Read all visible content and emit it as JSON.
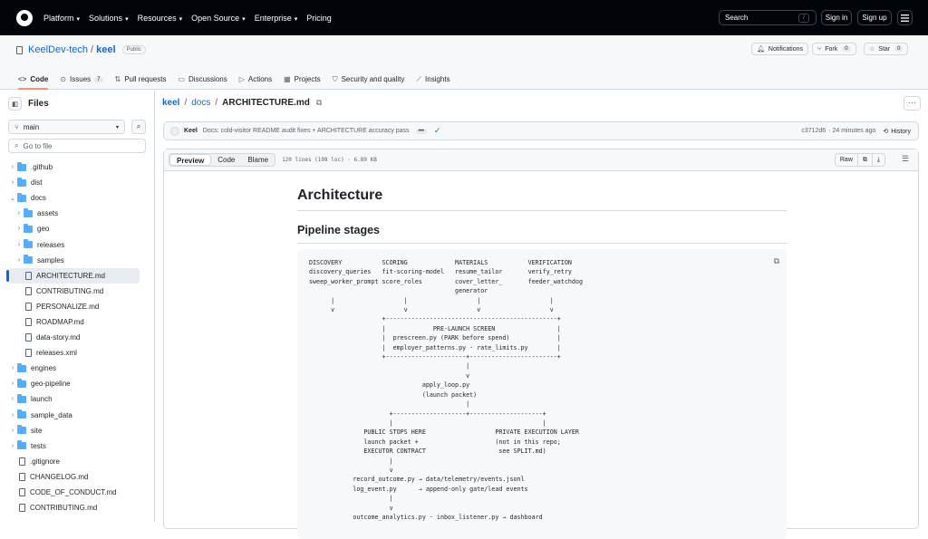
{
  "topbar": {
    "nav": [
      "Platform",
      "Solutions",
      "Resources",
      "Open Source",
      "Enterprise",
      "Pricing"
    ],
    "search_label": "Search",
    "search_key": "/",
    "signin": "Sign in",
    "signup": "Sign up"
  },
  "repo": {
    "owner": "KeelDev-tech",
    "sep": "/",
    "name": "keel",
    "visibility": "Public",
    "notifications": "Notifications",
    "fork": "Fork",
    "fork_count": "0",
    "star": "Star",
    "star_count": "0"
  },
  "tabs": [
    {
      "label": "Code",
      "icon": "code-icon"
    },
    {
      "label": "Issues",
      "count": "7",
      "icon": "issue-icon"
    },
    {
      "label": "Pull requests",
      "icon": "pull-request-icon"
    },
    {
      "label": "Discussions",
      "icon": "discussion-icon"
    },
    {
      "label": "Actions",
      "icon": "play-icon"
    },
    {
      "label": "Projects",
      "icon": "table-icon"
    },
    {
      "label": "Security and quality",
      "icon": "shield-icon"
    },
    {
      "label": "Insights",
      "icon": "graph-icon"
    }
  ],
  "sidebar": {
    "title": "Files",
    "branch": "main",
    "goto": "Go to file",
    "tree": [
      {
        "name": ".github",
        "type": "folder",
        "depth": 0,
        "expanded": false
      },
      {
        "name": "dist",
        "type": "folder",
        "depth": 0,
        "expanded": false
      },
      {
        "name": "docs",
        "type": "folder",
        "depth": 0,
        "expanded": true
      },
      {
        "name": "assets",
        "type": "folder",
        "depth": 1,
        "expanded": false
      },
      {
        "name": "geo",
        "type": "folder",
        "depth": 1,
        "expanded": false
      },
      {
        "name": "releases",
        "type": "folder",
        "depth": 1,
        "expanded": false
      },
      {
        "name": "samples",
        "type": "folder",
        "depth": 1,
        "expanded": false
      },
      {
        "name": "ARCHITECTURE.md",
        "type": "file",
        "depth": 1,
        "selected": true
      },
      {
        "name": "CONTRIBUTING.md",
        "type": "file",
        "depth": 1
      },
      {
        "name": "PERSONALIZE.md",
        "type": "file",
        "depth": 1
      },
      {
        "name": "ROADMAP.md",
        "type": "file",
        "depth": 1
      },
      {
        "name": "data-story.md",
        "type": "file",
        "depth": 1
      },
      {
        "name": "releases.xml",
        "type": "file",
        "depth": 1
      },
      {
        "name": "engines",
        "type": "folder",
        "depth": 0,
        "expanded": false
      },
      {
        "name": "geo-pipeline",
        "type": "folder",
        "depth": 0,
        "expanded": false
      },
      {
        "name": "launch",
        "type": "folder",
        "depth": 0,
        "expanded": false
      },
      {
        "name": "sample_data",
        "type": "folder",
        "depth": 0,
        "expanded": false
      },
      {
        "name": "site",
        "type": "folder",
        "depth": 0,
        "expanded": false
      },
      {
        "name": "tests",
        "type": "folder",
        "depth": 0,
        "expanded": false
      },
      {
        "name": ".gitignore",
        "type": "file",
        "depth": 0
      },
      {
        "name": "CHANGELOG.md",
        "type": "file",
        "depth": 0
      },
      {
        "name": "CODE_OF_CONDUCT.md",
        "type": "file",
        "depth": 0
      },
      {
        "name": "CONTRIBUTING.md",
        "type": "file",
        "depth": 0
      }
    ]
  },
  "breadcrumb": {
    "repo": "keel",
    "dir": "docs",
    "file": "ARCHITECTURE.md"
  },
  "commit": {
    "author": "Keel",
    "message": "Docs: cold-visitor README audit fixes + ARCHITECTURE accuracy pass",
    "ellipsis": "•••",
    "sha": "c3712d6",
    "time": "· 24 minutes ago",
    "history": "History"
  },
  "file": {
    "view_tabs": [
      "Preview",
      "Code",
      "Blame"
    ],
    "meta": "120 lines (108 loc) · 6.89 KB",
    "raw": "Raw"
  },
  "doc": {
    "h1": "Architecture",
    "h2": "Pipeline stages",
    "code": "DISCOVERY           SCORING             MATERIALS           VERIFICATION\ndiscovery_queries   fit-scoring-model   resume_tailor       verify_retry\nsweep_worker_prompt score_roles         cover_letter_       feeder_watchdog\n                                        generator\n      |                   |                   |                   |\n      v                   v                   v                   v\n                    +-----------------------------------------------+\n                    |             PRE-LAUNCH SCREEN                 |\n                    |  prescreen.py (PARK before spend)             |\n                    |  employer_patterns.py · rate_limits.py        |\n                    +----------------------+------------------------+\n                                           |\n                                           v\n                               apply_loop.py\n                               (launch packet)\n                                           |\n                      +--------------------+--------------------+\n                      |                                         |\n               PUBLIC STOPS HERE                   PRIVATE EXECUTION LAYER\n               launch packet +                     (not in this repo;\n               EXECUTOR CONTRACT                    see SPLIT.md)\n                      |\n                      v\n            record_outcome.py → data/telemetry/events.jsonl\n            log_event.py      → append-only gate/lead events\n                      |\n                      v\n            outcome_analytics.py · inbox_listener.py → dashboard"
  }
}
